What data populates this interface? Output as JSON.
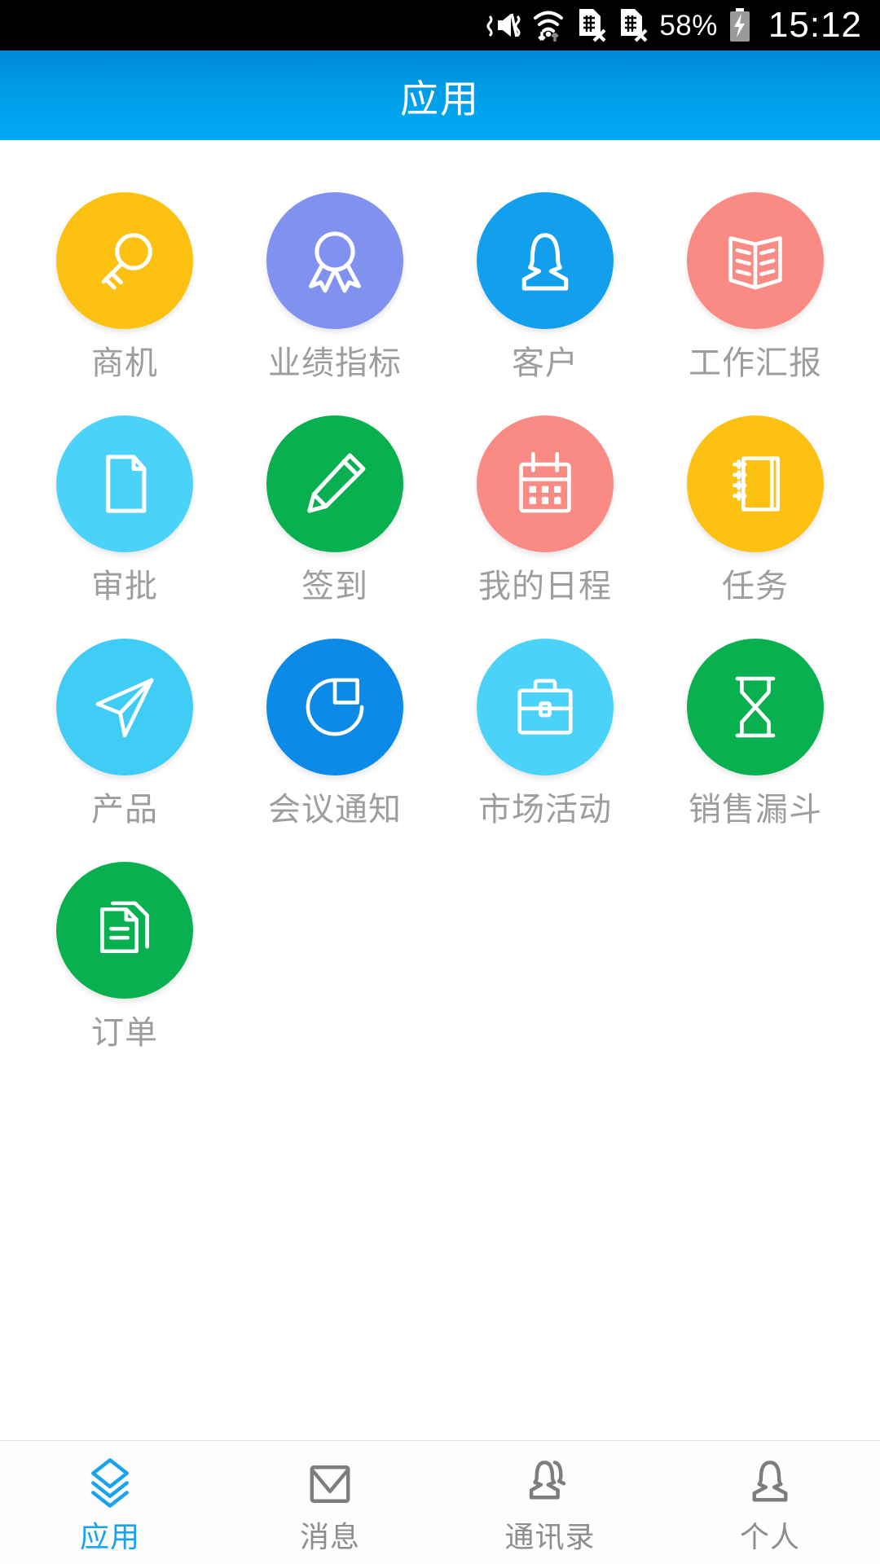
{
  "statusbar": {
    "icons": [
      "vibrate-mute-icon",
      "wifi-data-icon",
      "sim1-no-signal-icon",
      "sim2-no-signal-icon"
    ],
    "battery_percent": "58%",
    "battery_icon": "battery-charging-icon",
    "clock": "15:12"
  },
  "header": {
    "title": "应用",
    "bg_color": "#00a0ea",
    "text_color": "#ffffff"
  },
  "apps": [
    {
      "label": "商机",
      "icon": "magnifier-key-icon",
      "color": "#fcc111"
    },
    {
      "label": "业绩指标",
      "icon": "award-ribbon-icon",
      "color": "#8091f0"
    },
    {
      "label": "客户",
      "icon": "person-customer-icon",
      "color": "#129fee"
    },
    {
      "label": "工作汇报",
      "icon": "open-book-icon",
      "color": "#f98a84"
    },
    {
      "label": "审批",
      "icon": "document-page-icon",
      "color": "#4ad2f8"
    },
    {
      "label": "签到",
      "icon": "pencil-icon",
      "color": "#08b050"
    },
    {
      "label": "我的日程",
      "icon": "calendar-icon",
      "color": "#f98a84"
    },
    {
      "label": "任务",
      "icon": "notebook-icon",
      "color": "#fcc111"
    },
    {
      "label": "产品",
      "icon": "paper-plane-icon",
      "color": "#3fcdf6"
    },
    {
      "label": "会议通知",
      "icon": "pie-chart-icon",
      "color": "#0b8ae8"
    },
    {
      "label": "市场活动",
      "icon": "briefcase-icon",
      "color": "#4ad2f8"
    },
    {
      "label": "销售漏斗",
      "icon": "hourglass-icon",
      "color": "#08b050"
    },
    {
      "label": "订单",
      "icon": "documents-stack-icon",
      "color": "#08b050"
    }
  ],
  "tabbar": {
    "items": [
      {
        "label": "应用",
        "icon": "layers-stack-icon",
        "active": true
      },
      {
        "label": "消息",
        "icon": "envelope-icon",
        "active": false
      },
      {
        "label": "通讯录",
        "icon": "contacts-icon",
        "active": false
      },
      {
        "label": "个人",
        "icon": "user-icon",
        "active": false
      }
    ],
    "active_color": "#19a3ee",
    "inactive_color": "#8d8d8d"
  },
  "label_color": "#9d9d9d"
}
